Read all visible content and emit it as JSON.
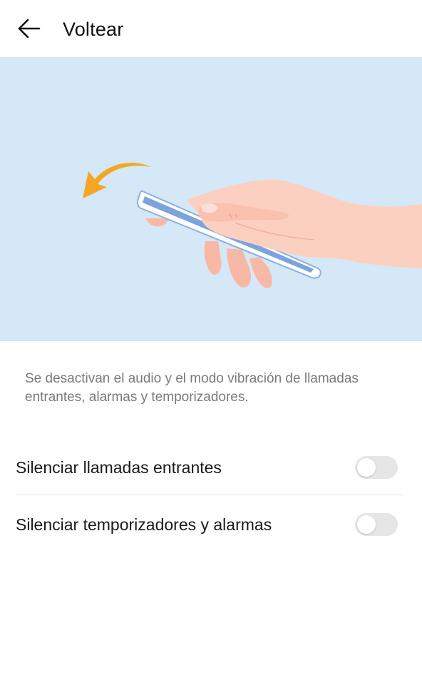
{
  "header": {
    "title": "Voltear",
    "back_icon": "arrow-left-icon"
  },
  "illustration": {
    "background_color": "#d4e8f7",
    "arrow_color": "#f5a623",
    "phone_color": "#7ba3dc",
    "hand_color": "#f9c6b4"
  },
  "description": "Se desactivan el audio y el modo vibración de llamadas entrantes, alarmas y temporizadores.",
  "settings": [
    {
      "label": "Silenciar llamadas entrantes",
      "enabled": false
    },
    {
      "label": "Silenciar temporizadores y alarmas",
      "enabled": false
    }
  ]
}
